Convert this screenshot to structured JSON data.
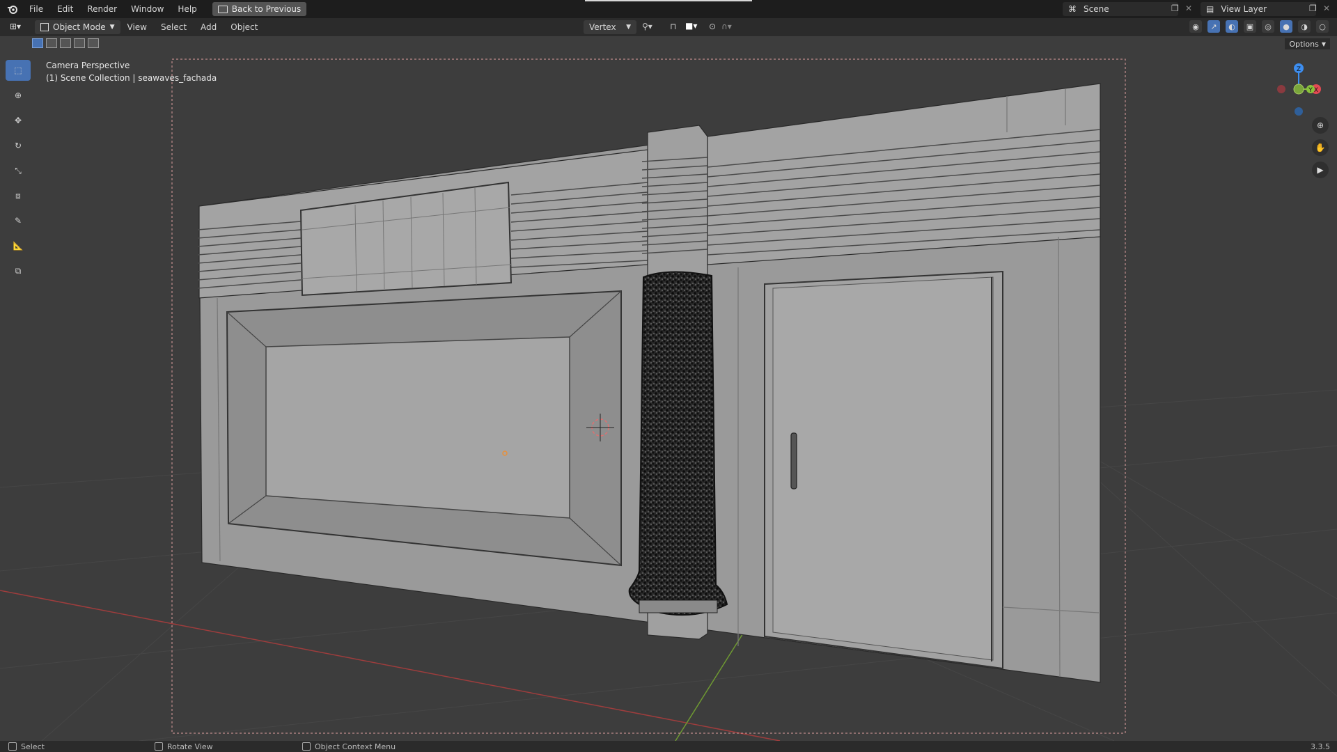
{
  "app": {
    "menu": [
      "File",
      "Edit",
      "Render",
      "Window",
      "Help"
    ],
    "back_button": "Back to Previous"
  },
  "scene": {
    "name": "Scene",
    "view_layer": "View Layer"
  },
  "header": {
    "mode": "Object Mode",
    "menus": [
      "View",
      "Select",
      "Add",
      "Object"
    ],
    "snap_target": "Vertex",
    "options_label": "Options"
  },
  "viewport": {
    "perspective_label": "Camera Perspective",
    "collection_label": "(1) Scene Collection | seawaves_fachada"
  },
  "gizmo": {
    "x": "X",
    "y": "Y",
    "z": "Z"
  },
  "status": {
    "select": "Select",
    "rotate": "Rotate View",
    "context_menu": "Object Context Menu",
    "version": "3.3.5"
  },
  "colors": {
    "accent": "#4772b3",
    "x_axis": "#e34a53",
    "y_axis": "#8ac23c",
    "z_axis": "#3d8ef0"
  },
  "icons": [
    "blender-logo-icon",
    "editor-type-icon",
    "select-box-icon",
    "cursor-icon",
    "move-icon",
    "rotate-icon",
    "scale-icon",
    "transform-icon",
    "annotate-icon",
    "measure-icon",
    "add-cube-icon",
    "zoom-icon",
    "pan-hand-icon",
    "camera-icon"
  ]
}
